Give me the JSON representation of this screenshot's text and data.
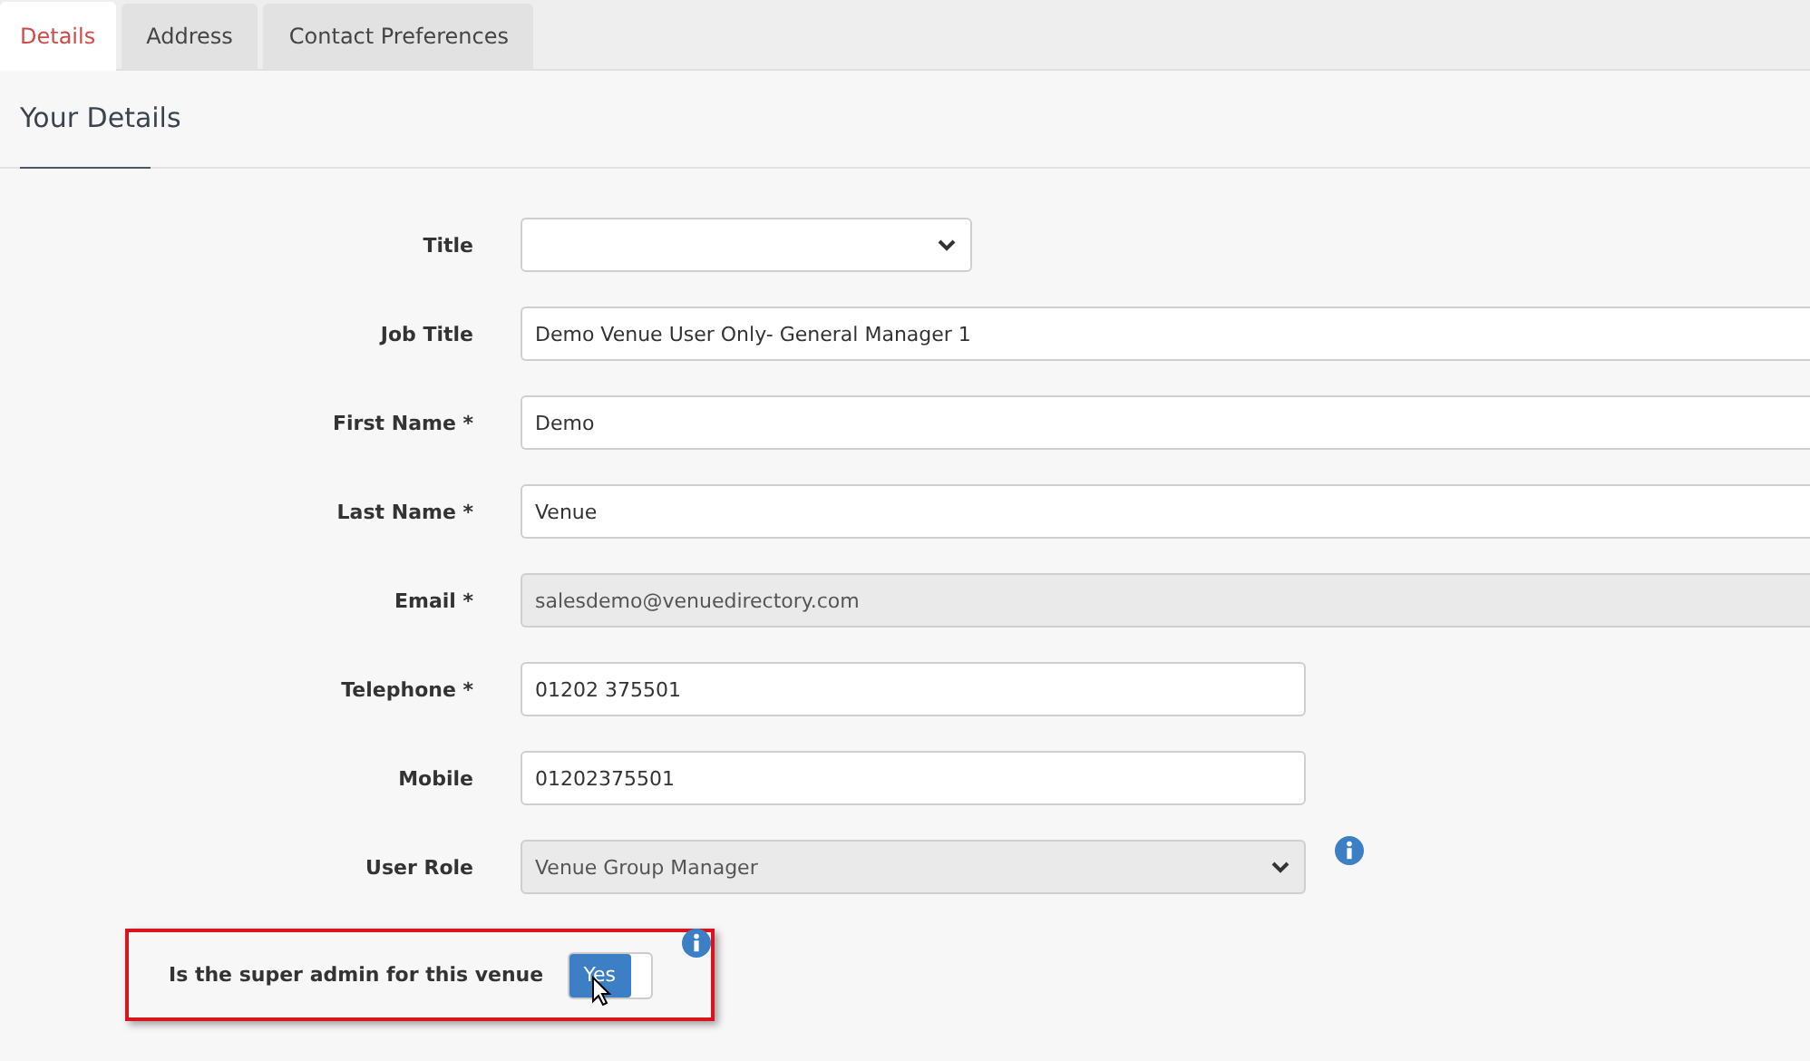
{
  "tabs": [
    {
      "label": "Details",
      "selected": true
    },
    {
      "label": "Address",
      "selected": false
    },
    {
      "label": "Contact Preferences",
      "selected": false
    }
  ],
  "heading": "Your Details",
  "fields": [
    {
      "label": "Title",
      "kind": "select",
      "disabled": false
    },
    {
      "label": "Job Title",
      "kind": "text",
      "value": "Demo Venue User Only- General Manager 1",
      "disabled": false
    },
    {
      "label": "First Name *",
      "kind": "text",
      "value": "Demo",
      "disabled": false
    },
    {
      "label": "Last Name *",
      "kind": "text",
      "value": "Venue",
      "disabled": false
    },
    {
      "label": "Email *",
      "kind": "text",
      "value": "salesdemo@venuedirectory.com",
      "disabled": true
    },
    {
      "label": "Telephone *",
      "kind": "text",
      "value": "01202 375501",
      "disabled": false
    },
    {
      "label": "Mobile",
      "kind": "text",
      "value": "01202375501",
      "disabled": false
    },
    {
      "label": "User Role",
      "kind": "select",
      "value": "Venue Group Manager",
      "disabled": true,
      "info": true
    }
  ],
  "super_admin": {
    "label": "Is the super admin for this venue",
    "toggle_label": "Yes",
    "on": true,
    "info": true,
    "highlighted": true
  }
}
